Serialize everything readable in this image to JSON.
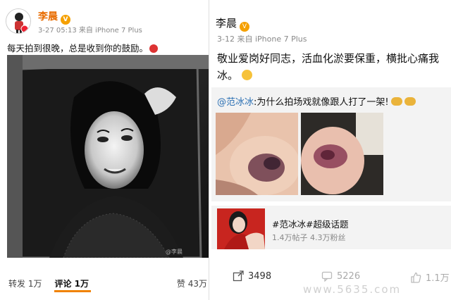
{
  "left_post": {
    "author": "李晨",
    "meta": "3-27 05:13  来自 iPhone 7 Plus",
    "text": "每天拍到很晚，总是收到你的鼓励。",
    "photo_watermark": "@李晨",
    "actions": {
      "repost": "转发 1万",
      "comment": "评论 1万",
      "like": "赞 43万"
    }
  },
  "right_post": {
    "author": "李晨",
    "meta": "3-12  来自 iPhone 7 Plus",
    "text_line1": "敬业爱岗好同志，活血化淤要保重，横批心痛我",
    "text_line2": "冰。",
    "repost": {
      "mention": "@范冰冰",
      "text": ":为什么拍场戏就像跟人打了一架!"
    },
    "topic": {
      "title": "#范冰冰#超级话题",
      "sub": "1.4万帖子 4.3万粉丝"
    },
    "actions": {
      "repost_count": "3498",
      "comment_count": "5226",
      "like_count": "1.1万"
    }
  },
  "watermark": "www.5635.com",
  "colors": {
    "author_orange": "#e86c00",
    "accent_tab": "#f08200",
    "mention_blue": "#2a6fb3",
    "repost_bg": "#f3f3f3"
  }
}
